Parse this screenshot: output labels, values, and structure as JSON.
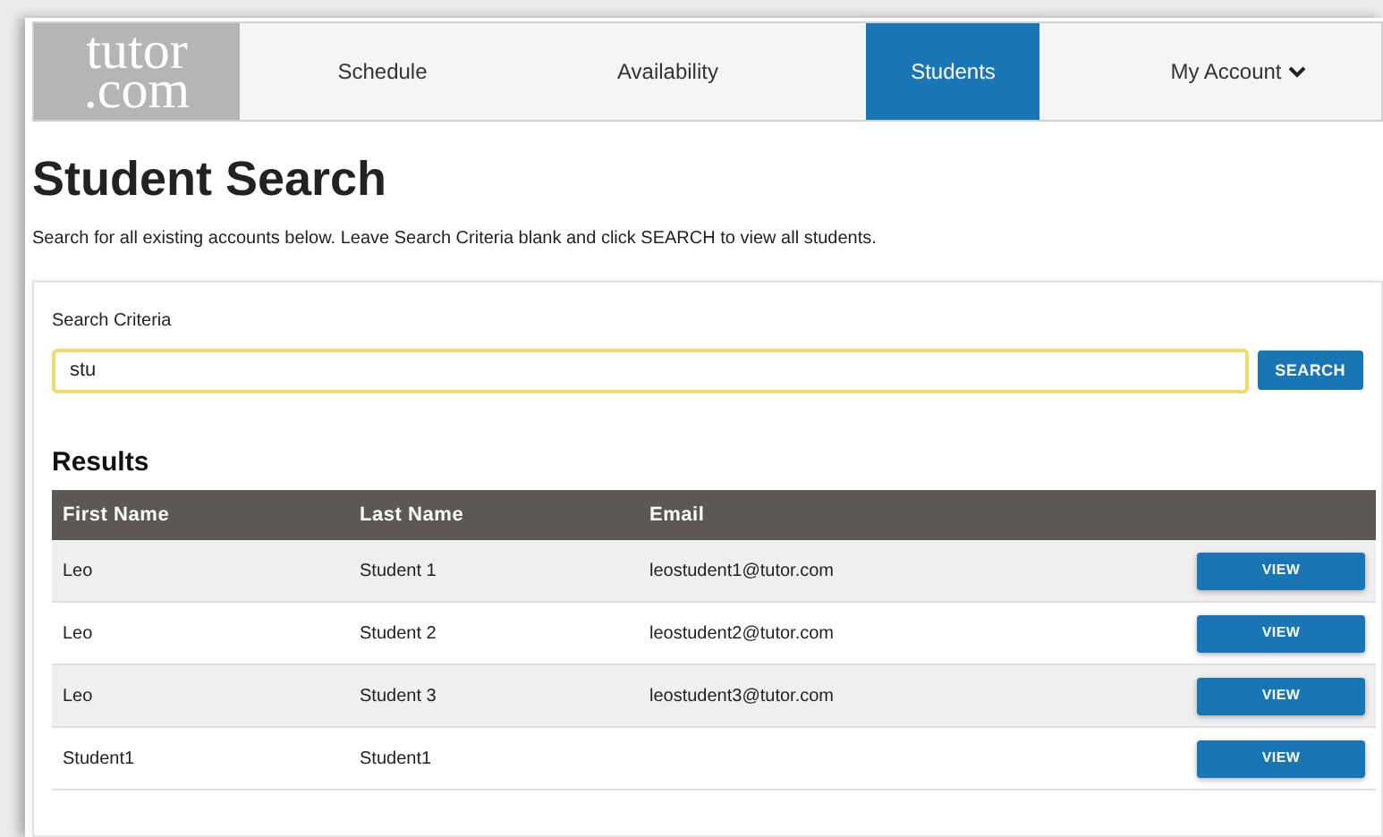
{
  "logo": {
    "line_1": "tutor",
    "line_2": ".com"
  },
  "nav": [
    {
      "label": "Schedule",
      "selected": false,
      "dropdown": false
    },
    {
      "label": "Availability",
      "selected": false,
      "dropdown": false
    },
    {
      "label": "Students",
      "selected": true,
      "dropdown": false
    },
    {
      "label": "My Account",
      "selected": false,
      "dropdown": true
    }
  ],
  "title": "Student Search",
  "description": "Search for all existing accounts below. Leave Search Criteria blank and click SEARCH to view all students.",
  "search": {
    "label": "Search Criteria",
    "value": "stu",
    "button": "SEARCH"
  },
  "results": {
    "title": "Results",
    "columns": [
      "First Name",
      "Last Name",
      "Email"
    ],
    "rows": [
      {
        "first": "Leo",
        "last": "Student 1",
        "email": "leostudent1@tutor.com",
        "action": "VIEW"
      },
      {
        "first": "Leo",
        "last": "Student 2",
        "email": "leostudent2@tutor.com",
        "action": "VIEW"
      },
      {
        "first": "Leo",
        "last": "Student 3",
        "email": "leostudent3@tutor.com",
        "action": "VIEW"
      },
      {
        "first": "Student1",
        "last": "Student1",
        "email": "",
        "action": "VIEW"
      }
    ]
  }
}
